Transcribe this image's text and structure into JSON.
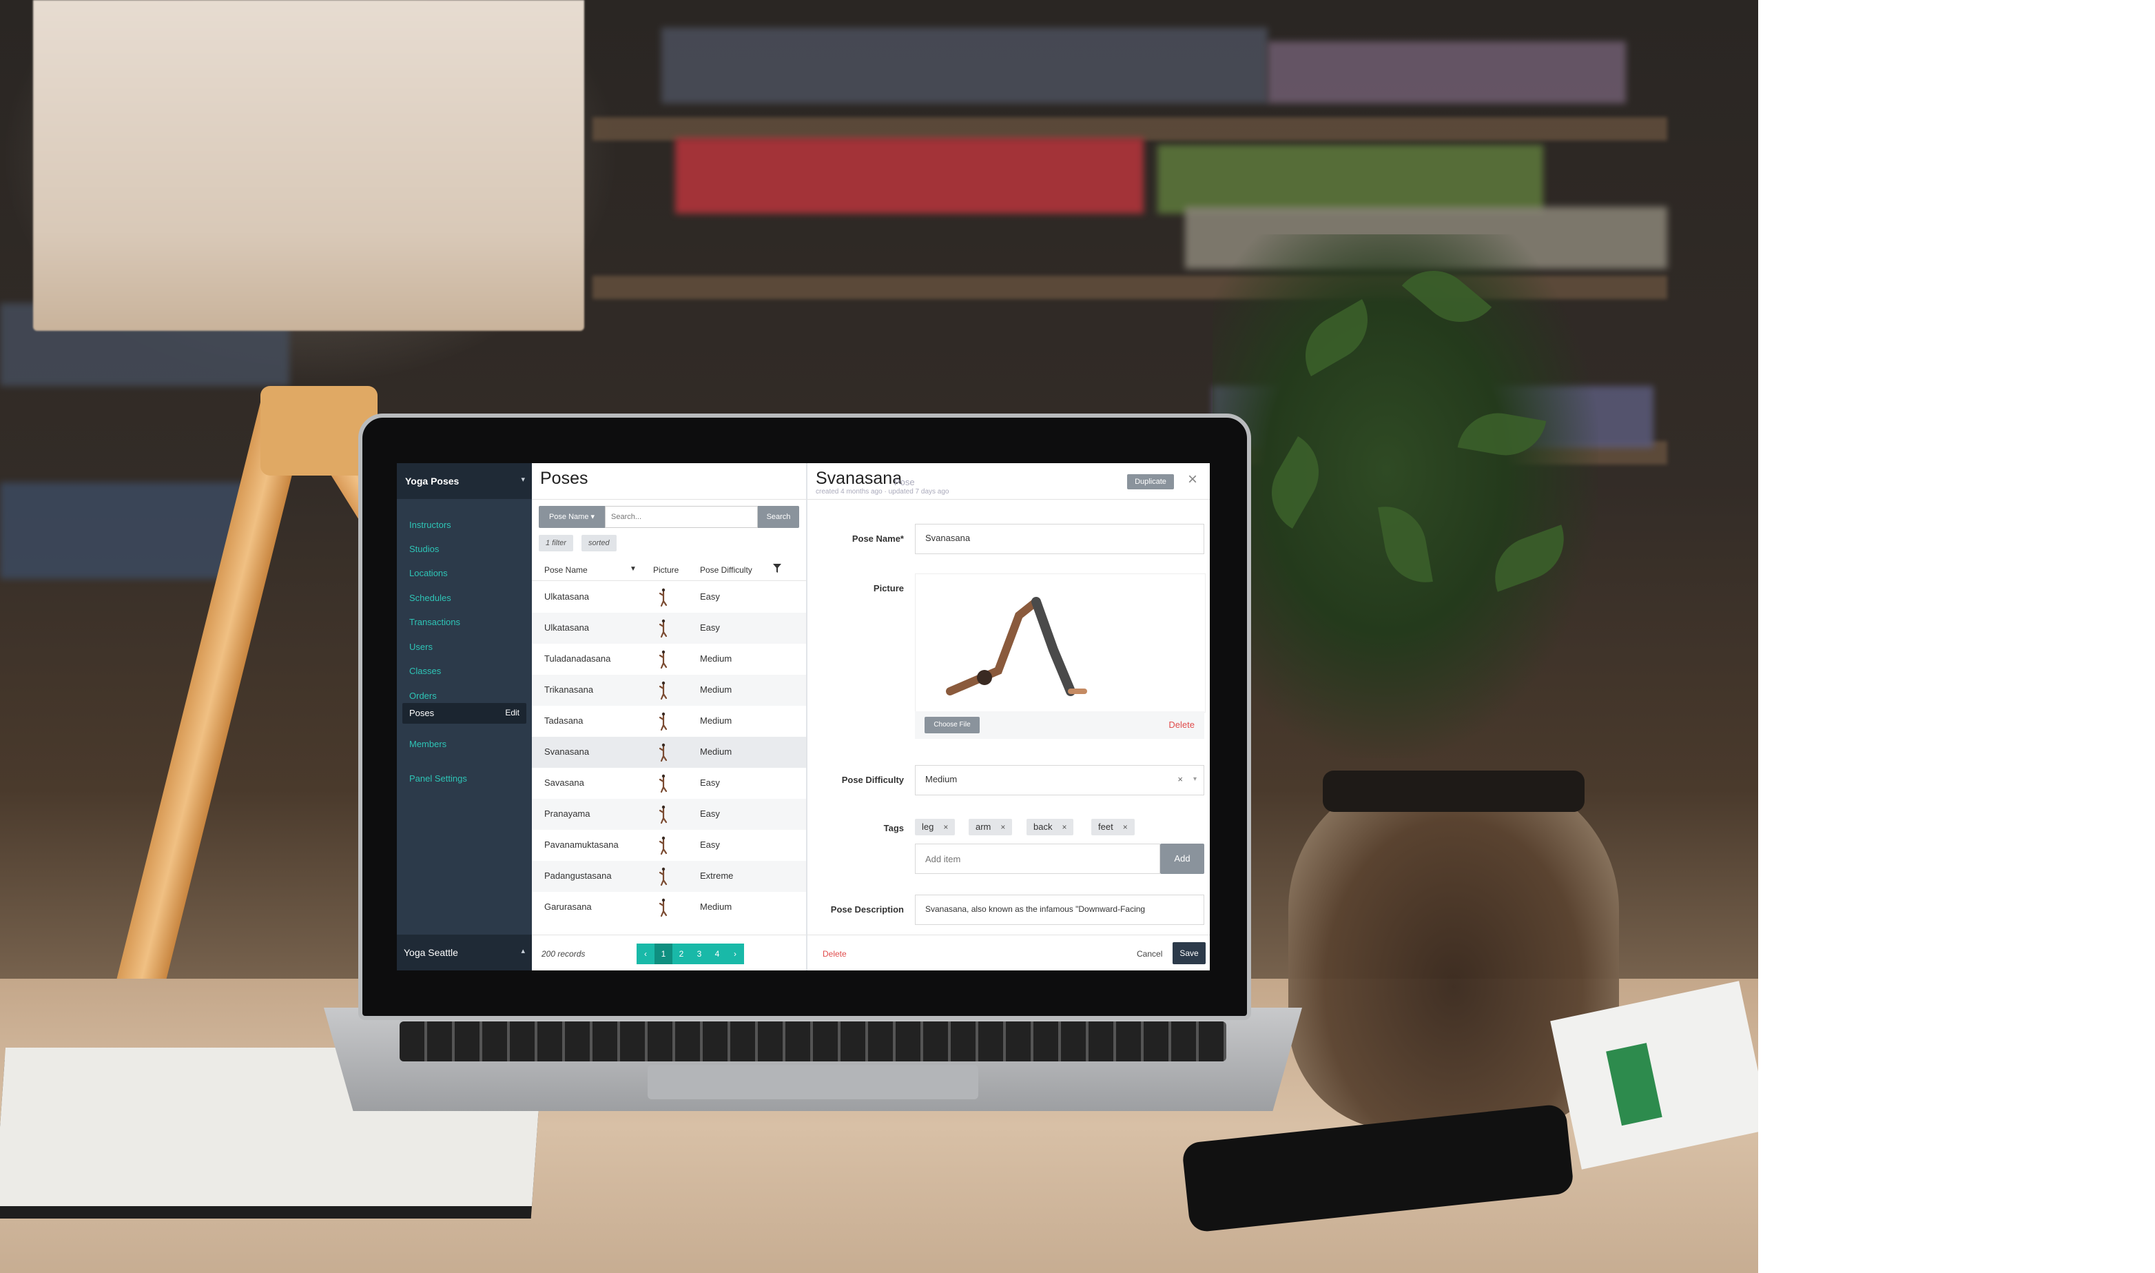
{
  "colors": {
    "sidebar_bg": "#2c3a4a",
    "sidebar_link": "#2ec4b6",
    "pager": "#19b9a8",
    "danger": "#e04c4c",
    "neutral_button": "#8a939c"
  },
  "sidebar": {
    "header": "Yoga Poses",
    "items": [
      "Instructors",
      "Studios",
      "Locations",
      "Schedules",
      "Transactions",
      "Users",
      "Classes",
      "Orders"
    ],
    "active_item": "Poses",
    "active_edit": "Edit",
    "after_items": [
      "Members"
    ],
    "settings": "Panel Settings",
    "footer": "Yoga Seattle"
  },
  "list": {
    "title": "Poses",
    "field_button": "Pose Name ▾",
    "search_placeholder": "Search...",
    "search_button": "Search",
    "chips": [
      "1 filter",
      "sorted"
    ],
    "columns": [
      "Pose Name",
      "Picture",
      "Pose Difficulty"
    ],
    "rows": [
      {
        "name": "Ulkatasana",
        "difficulty": "Easy"
      },
      {
        "name": "Ulkatasana",
        "difficulty": "Easy"
      },
      {
        "name": "Tuladanadasana",
        "difficulty": "Medium"
      },
      {
        "name": "Trikanasana",
        "difficulty": "Medium"
      },
      {
        "name": "Tadasana",
        "difficulty": "Medium"
      },
      {
        "name": "Svanasana",
        "difficulty": "Medium"
      },
      {
        "name": "Savasana",
        "difficulty": "Easy"
      },
      {
        "name": "Pranayama",
        "difficulty": "Easy"
      },
      {
        "name": "Pavanamuktasana",
        "difficulty": "Easy"
      },
      {
        "name": "Padangustasana",
        "difficulty": "Extreme"
      },
      {
        "name": "Garurasana",
        "difficulty": "Medium"
      }
    ],
    "record_count": "200 records",
    "pager": [
      "‹",
      "1",
      "2",
      "3",
      "4",
      "›"
    ],
    "current_page": "1"
  },
  "detail": {
    "title": "Svanasana",
    "subtitle": "Pose",
    "meta": "created 4 months ago · updated 7 days ago",
    "duplicate": "Duplicate",
    "pose_name_label": "Pose Name*",
    "pose_name_value": "Svanasana",
    "picture_label": "Picture",
    "choose_file": "Choose File",
    "picture_delete": "Delete",
    "difficulty_label": "Pose Difficulty",
    "difficulty_value": "Medium",
    "tags_label": "Tags",
    "tags": [
      "leg",
      "arm",
      "back",
      "feet"
    ],
    "add_item_placeholder": "Add item",
    "add_button": "Add",
    "description_label": "Pose Description",
    "description_value": "Svanasana,  also known as the infamous \"Downward-Facing",
    "delete": "Delete",
    "cancel": "Cancel",
    "save": "Save"
  }
}
